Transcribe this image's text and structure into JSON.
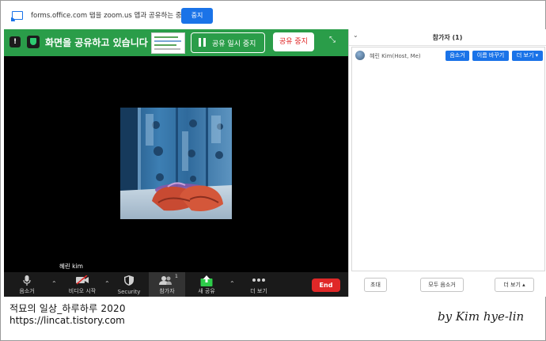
{
  "notification": {
    "message": "forms.office.com 탭을 zoom.us 앱과 공유하는 중",
    "stop_label": "중지"
  },
  "share_bar": {
    "sharing_text": "화면을 공유하고 있습니다",
    "pause_label": "공유 일시 중지",
    "stop_label": "공유 중지",
    "info_icon": "!"
  },
  "video": {
    "participant_name": "혜린 kim"
  },
  "toolbar": {
    "items": [
      {
        "icon": "mic-icon",
        "label": "음소거"
      },
      {
        "icon": "video-off-icon",
        "label": "비디오 시작"
      },
      {
        "icon": "security-shield-icon",
        "label": "Security"
      },
      {
        "icon": "participants-icon",
        "label": "참가자",
        "count": "1"
      },
      {
        "icon": "new-share-icon",
        "label": "새 공유"
      },
      {
        "icon": "more-icon",
        "label": "더 보기"
      }
    ],
    "end_label": "End"
  },
  "participants_panel": {
    "title": "참가자 (1)",
    "participant": {
      "name": "혜린 Kim(Host, Me)",
      "mute_label": "음소거",
      "rename_label": "이름 바꾸기",
      "more_label": "더 보기 ▾"
    },
    "invite_label": "초대",
    "mute_all_label": "모두 음소거",
    "more_label": "더 보기 ▴"
  },
  "caption": {
    "line1": "적묘의 일상_하루하루 2020",
    "line2": "https://lincat.tistory.com",
    "signature": "by Kim hye-lin"
  },
  "colors": {
    "share_green": "#2a9d49",
    "accent_blue": "#1a73e8",
    "end_red": "#e02828"
  }
}
